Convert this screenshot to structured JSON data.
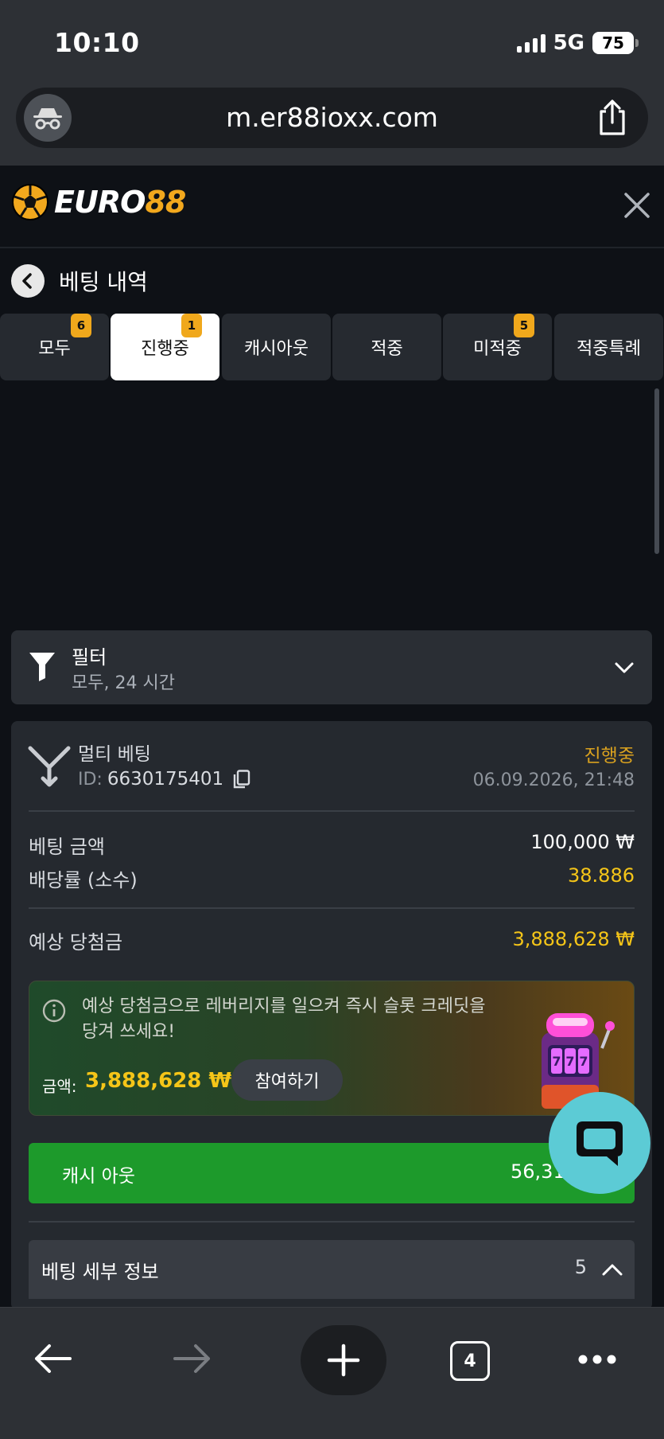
{
  "status_bar": {
    "time": "10:10",
    "network": "5G",
    "battery": "75"
  },
  "browser": {
    "url": "m.er88ioxx.com",
    "tab_count": "4"
  },
  "site": {
    "logo_white": "EURO",
    "logo_gold": "88"
  },
  "page": {
    "title": "베팅 내역"
  },
  "tabs": [
    {
      "label": "모두",
      "badge": "6",
      "active": false
    },
    {
      "label": "진행중",
      "badge": "1",
      "active": true
    },
    {
      "label": "캐시아웃",
      "badge": null,
      "active": false
    },
    {
      "label": "적중",
      "badge": null,
      "active": false
    },
    {
      "label": "미적중",
      "badge": "5",
      "active": false
    },
    {
      "label": "적중특례",
      "badge": null,
      "active": false
    }
  ],
  "filter": {
    "title": "필터",
    "value": "모두, 24 시간"
  },
  "bet": {
    "type": "멀티 베팅",
    "id_label": "ID:",
    "id": "6630175401",
    "status": "진행중",
    "datetime": "06.09.2026, 21:48",
    "stake_label": "베팅 금액",
    "stake": "100,000 ₩",
    "odds_label": "배당률 (소수)",
    "odds": "38.886",
    "payout_label": "예상 당첨금",
    "payout": "3,888,628 ₩"
  },
  "promo": {
    "text": "예상 당첨금으로 레버리지를 일으켜 즉시 슬롯 크레딧을 당겨 쓰세요!",
    "amount_label": "금액:",
    "amount": "3,888,628 ₩",
    "button": "참여하기"
  },
  "cashout": {
    "label": "캐시 아웃",
    "value": "56,31"
  },
  "details": {
    "title": "베팅 세부 정보",
    "count": "5"
  },
  "colors": {
    "accent_gold": "#f0a81c",
    "status_gold": "#d9a11f",
    "value_yellow": "#f5c518",
    "cashout_green": "#1d9a2b",
    "chat_teal": "#5ccbd5"
  },
  "icons": {
    "incognito": "incognito-icon",
    "share": "share-icon",
    "close": "close-icon",
    "back": "chevron-left-icon",
    "filter": "funnel-icon",
    "bet_type": "multi-bet-icon",
    "copy": "copy-icon",
    "info": "info-icon",
    "slot": "slot-machine-icon",
    "chat": "chat-bubble-icon"
  }
}
